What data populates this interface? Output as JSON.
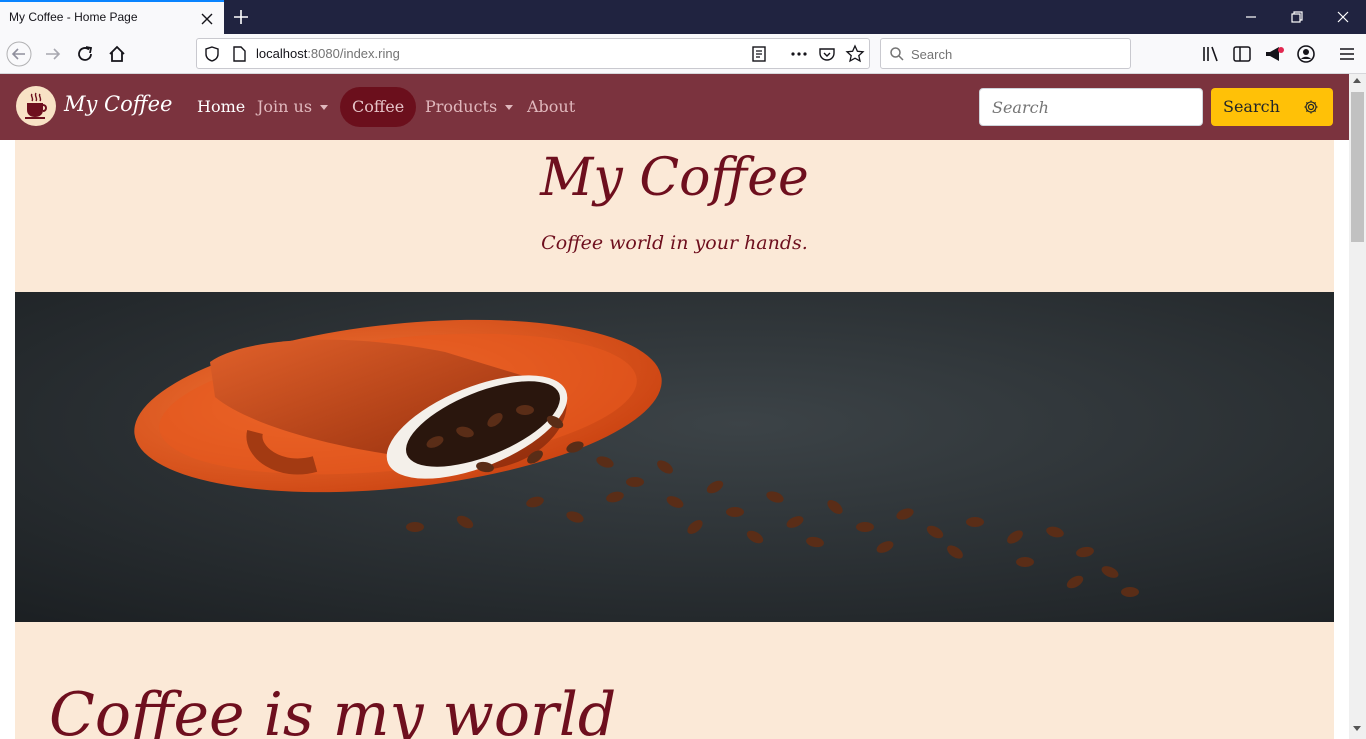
{
  "browser": {
    "tab_title": "My Coffee - Home Page",
    "url_host": "localhost",
    "url_rest": ":8080/index.ring",
    "search_placeholder": "Search"
  },
  "site": {
    "brand": "My Coffee",
    "nav": [
      {
        "label": "Home",
        "active": true
      },
      {
        "label": "Join us",
        "dropdown": true
      },
      {
        "label": "Coffee",
        "pill": true
      },
      {
        "label": "Products",
        "dropdown": true
      },
      {
        "label": "About"
      }
    ],
    "search_placeholder": "Search",
    "search_button": "Search"
  },
  "hero": {
    "title": "My Coffee",
    "subtitle": "Coffee world in your hands.",
    "image_icon": "coffee-cup-beans-image"
  },
  "section": {
    "title": "Coffee is my world"
  },
  "colors": {
    "nav_bg": "#7b333e",
    "hero_bg": "#fbe9d7",
    "title_text": "#6e0f1e",
    "search_button": "#ffc107"
  }
}
